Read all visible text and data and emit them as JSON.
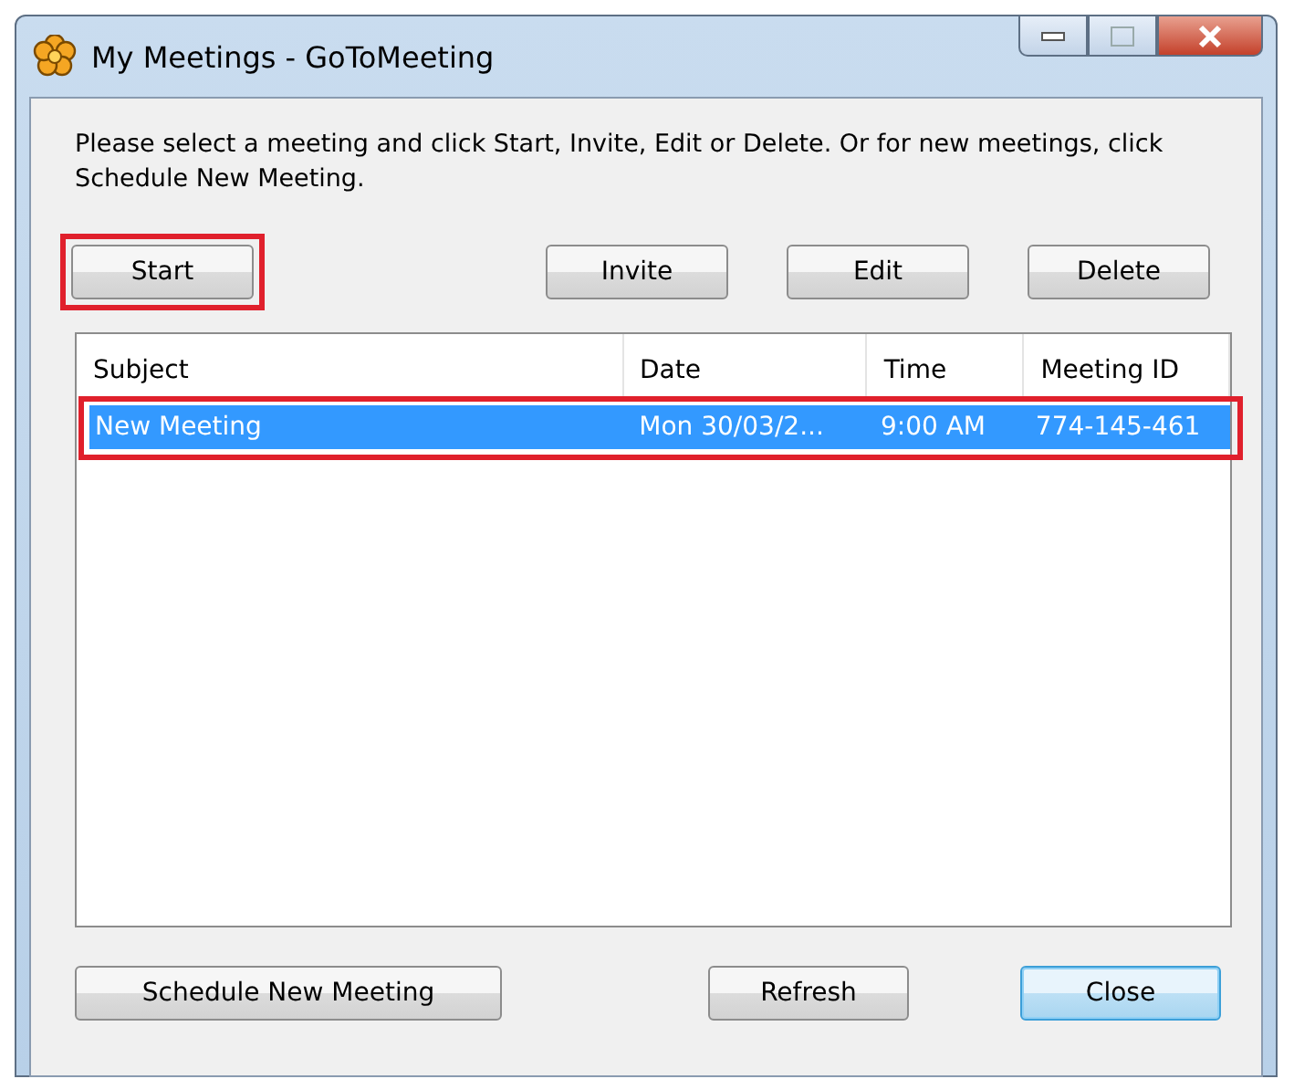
{
  "window": {
    "title": "My Meetings - GoToMeeting"
  },
  "instructions": "Please select a meeting and click Start, Invite, Edit or Delete. Or for new meetings, click Schedule New Meeting.",
  "top_buttons": [
    {
      "label": "Start",
      "highlighted": true
    },
    {
      "label": "Invite",
      "highlighted": false
    },
    {
      "label": "Edit",
      "highlighted": false
    },
    {
      "label": "Delete",
      "highlighted": false
    }
  ],
  "table": {
    "columns": [
      "Subject",
      "Date",
      "Time",
      "Meeting ID"
    ],
    "rows": [
      {
        "cells": [
          "New Meeting",
          "Mon 30/03/2...",
          "9:00 AM",
          "774-145-461"
        ],
        "selected": true,
        "highlighted": true
      }
    ]
  },
  "bottom_buttons": [
    {
      "label": "Schedule New Meeting",
      "default": false
    },
    {
      "label": "Refresh",
      "default": false
    },
    {
      "label": "Close",
      "default": true
    }
  ]
}
